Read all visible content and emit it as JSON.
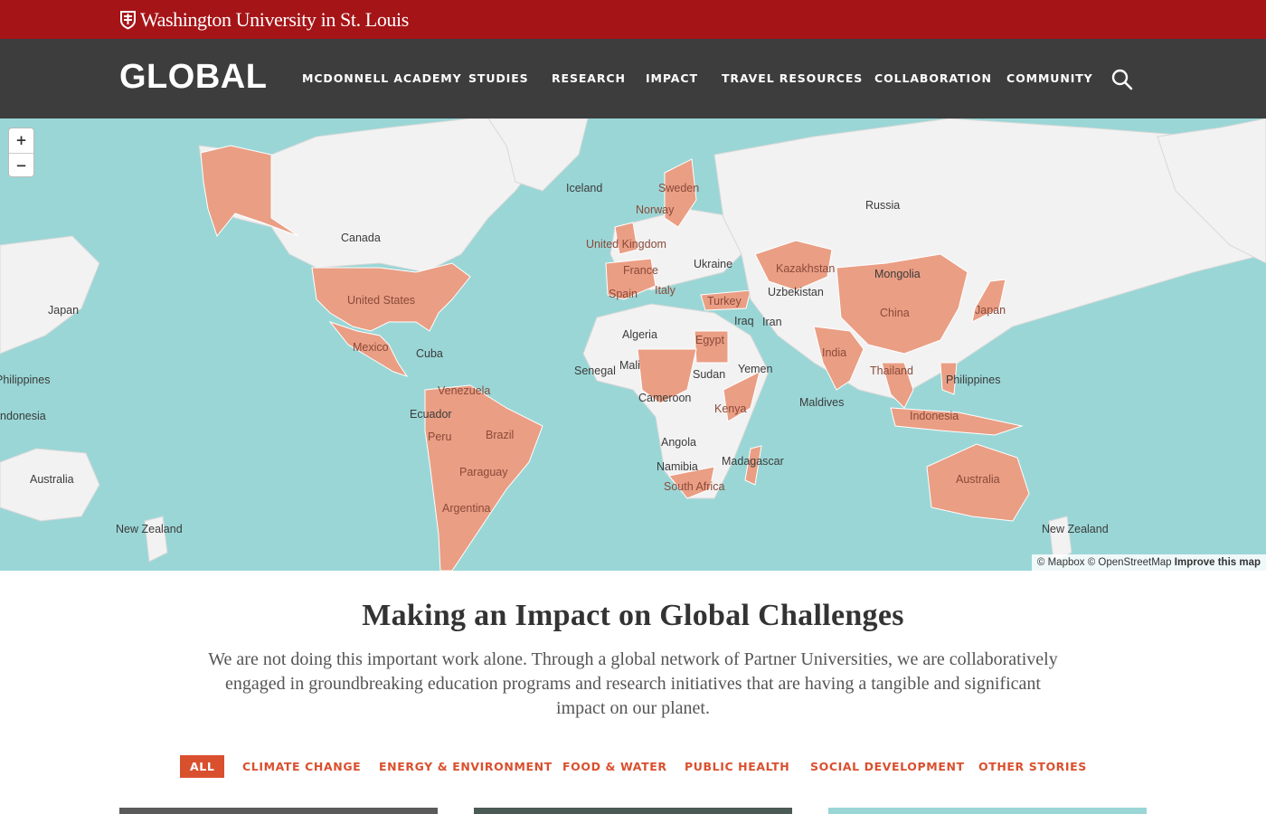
{
  "brand": {
    "university_name": "Washington University in St. Louis",
    "site_title": "GLOBAL"
  },
  "nav": {
    "items": [
      "MCDONNELL ACADEMY",
      "STUDIES",
      "RESEARCH",
      "IMPACT",
      "TRAVEL RESOURCES",
      "COLLABORATION",
      "COMMUNITY"
    ],
    "search_icon": "search-icon"
  },
  "map": {
    "zoom_in": "+",
    "zoom_out": "−",
    "attribution": {
      "mapbox": "© Mapbox",
      "osm": "© OpenStreetMap",
      "improve": "Improve this map"
    },
    "labels": [
      "Iceland",
      "Sweden",
      "Norway",
      "Russia",
      "Canada",
      "United Kingdom",
      "Ukraine",
      "Kazakhstan",
      "Mongolia",
      "France",
      "Spain",
      "Italy",
      "Turkey",
      "Uzbekistan",
      "United States",
      "China",
      "Japan",
      "Iraq",
      "Iran",
      "Egypt",
      "India",
      "Mexico",
      "Cuba",
      "Algeria",
      "Mali",
      "Senegal",
      "Sudan",
      "Yemen",
      "Thailand",
      "Philippines",
      "Philippines",
      "Venezuela",
      "Cameroon",
      "Maldives",
      "Kenya",
      "Ecuador",
      "Indonesia",
      "Brazil",
      "Peru",
      "Angola",
      "Namibia",
      "Madagascar",
      "Paraguay",
      "South Africa",
      "Australia",
      "Argentina",
      "New Zealand",
      "New Zealand",
      "Japan",
      "ndonesia",
      "Australia"
    ],
    "colors": {
      "ocean": "#9ad6d6",
      "land": "#f2f2f2",
      "highlighted": "#ea9e84"
    }
  },
  "content": {
    "headline": "Making an Impact on Global Challenges",
    "intro": "We are not doing this important work alone. Through a global network of Partner Universities, we are collaboratively engaged in groundbreaking education programs and research initiatives that are having a tangible and significant impact on our planet."
  },
  "filters": [
    "ALL",
    "CLIMATE CHANGE",
    "ENERGY & ENVIRONMENT",
    "FOOD & WATER",
    "PUBLIC HEALTH",
    "SOCIAL DEVELOPMENT",
    "OTHER STORIES"
  ],
  "colors": {
    "brand_red": "#a51417",
    "nav_bg": "#3d3d3d",
    "accent": "#d9502e"
  }
}
